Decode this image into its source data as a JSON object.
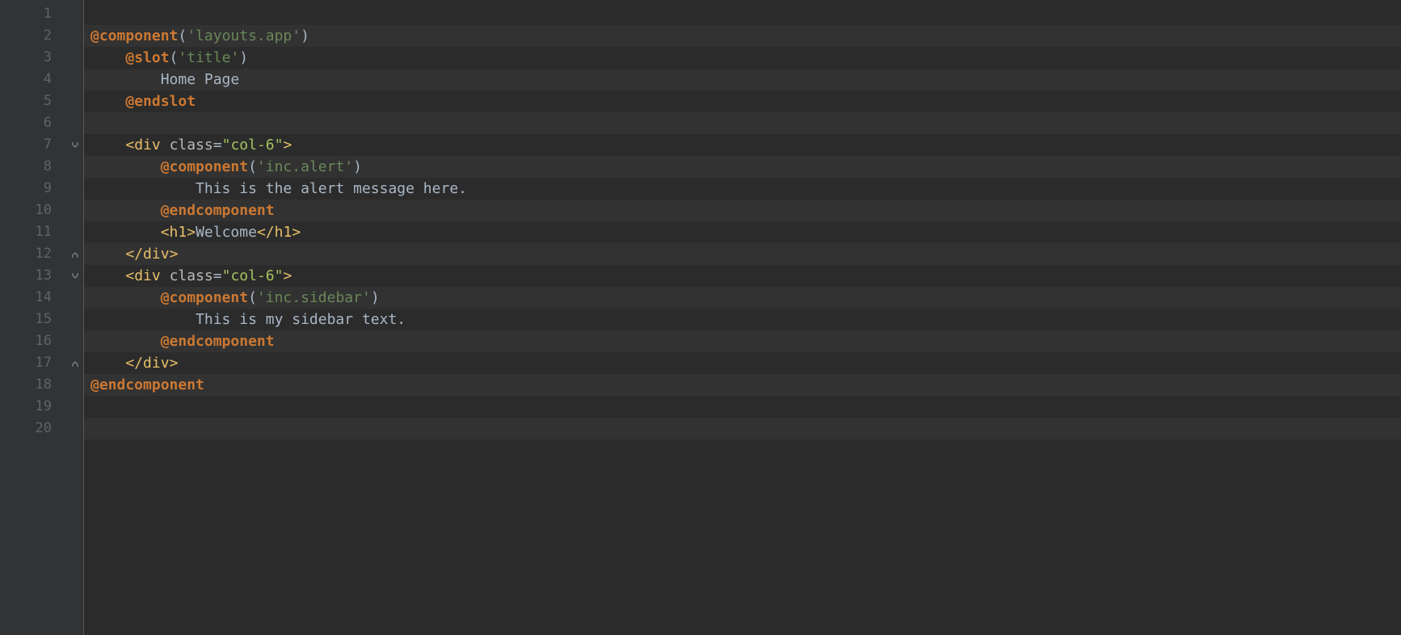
{
  "lineNumbers": [
    "1",
    "2",
    "3",
    "4",
    "5",
    "6",
    "7",
    "8",
    "9",
    "10",
    "11",
    "12",
    "13",
    "14",
    "15",
    "16",
    "17",
    "18",
    "19",
    "20"
  ],
  "foldMarkers": {
    "7": "open",
    "12": "close",
    "13": "open",
    "17": "close"
  },
  "code": {
    "lines": [
      [],
      [
        {
          "cls": "tok-directive",
          "t": "@component"
        },
        {
          "cls": "tok-paren",
          "t": "("
        },
        {
          "cls": "tok-string",
          "t": "'layouts.app'"
        },
        {
          "cls": "tok-paren",
          "t": ")"
        }
      ],
      [
        {
          "cls": "tok-text",
          "t": "    "
        },
        {
          "cls": "tok-directive",
          "t": "@slot"
        },
        {
          "cls": "tok-paren",
          "t": "("
        },
        {
          "cls": "tok-string",
          "t": "'title'"
        },
        {
          "cls": "tok-paren",
          "t": ")"
        }
      ],
      [
        {
          "cls": "tok-text",
          "t": "        Home Page"
        }
      ],
      [
        {
          "cls": "tok-text",
          "t": "    "
        },
        {
          "cls": "tok-directive",
          "t": "@endslot"
        }
      ],
      [],
      [
        {
          "cls": "tok-text",
          "t": "    "
        },
        {
          "cls": "tok-tag-bracket",
          "t": "<"
        },
        {
          "cls": "tok-tag-name",
          "t": "div "
        },
        {
          "cls": "tok-attr-name",
          "t": "class"
        },
        {
          "cls": "tok-attr-eq",
          "t": "="
        },
        {
          "cls": "tok-attr-quote",
          "t": "\""
        },
        {
          "cls": "tok-attr-value",
          "t": "col-6"
        },
        {
          "cls": "tok-attr-quote",
          "t": "\""
        },
        {
          "cls": "tok-tag-bracket",
          "t": ">"
        }
      ],
      [
        {
          "cls": "tok-text",
          "t": "        "
        },
        {
          "cls": "tok-directive",
          "t": "@component"
        },
        {
          "cls": "tok-paren",
          "t": "("
        },
        {
          "cls": "tok-string",
          "t": "'inc.alert'"
        },
        {
          "cls": "tok-paren",
          "t": ")"
        }
      ],
      [
        {
          "cls": "tok-text",
          "t": "            This is the alert message here."
        }
      ],
      [
        {
          "cls": "tok-text",
          "t": "        "
        },
        {
          "cls": "tok-directive",
          "t": "@endcomponent"
        }
      ],
      [
        {
          "cls": "tok-text",
          "t": "        "
        },
        {
          "cls": "tok-tag-bracket",
          "t": "<"
        },
        {
          "cls": "tok-tag-name",
          "t": "h1"
        },
        {
          "cls": "tok-tag-bracket",
          "t": ">"
        },
        {
          "cls": "tok-text",
          "t": "Welcome"
        },
        {
          "cls": "tok-tag-bracket",
          "t": "</"
        },
        {
          "cls": "tok-tag-name",
          "t": "h1"
        },
        {
          "cls": "tok-tag-bracket",
          "t": ">"
        }
      ],
      [
        {
          "cls": "tok-text",
          "t": "    "
        },
        {
          "cls": "tok-tag-bracket",
          "t": "</"
        },
        {
          "cls": "tok-tag-name",
          "t": "div"
        },
        {
          "cls": "tok-tag-bracket",
          "t": ">"
        }
      ],
      [
        {
          "cls": "tok-text",
          "t": "    "
        },
        {
          "cls": "tok-tag-bracket",
          "t": "<"
        },
        {
          "cls": "tok-tag-name",
          "t": "div "
        },
        {
          "cls": "tok-attr-name",
          "t": "class"
        },
        {
          "cls": "tok-attr-eq",
          "t": "="
        },
        {
          "cls": "tok-attr-quote",
          "t": "\""
        },
        {
          "cls": "tok-attr-value",
          "t": "col-6"
        },
        {
          "cls": "tok-attr-quote",
          "t": "\""
        },
        {
          "cls": "tok-tag-bracket",
          "t": ">"
        }
      ],
      [
        {
          "cls": "tok-text",
          "t": "        "
        },
        {
          "cls": "tok-directive",
          "t": "@component"
        },
        {
          "cls": "tok-paren",
          "t": "("
        },
        {
          "cls": "tok-string",
          "t": "'inc.sidebar'"
        },
        {
          "cls": "tok-paren",
          "t": ")"
        }
      ],
      [
        {
          "cls": "tok-text",
          "t": "            This is my sidebar text."
        }
      ],
      [
        {
          "cls": "tok-text",
          "t": "        "
        },
        {
          "cls": "tok-directive",
          "t": "@endcomponent"
        }
      ],
      [
        {
          "cls": "tok-text",
          "t": "    "
        },
        {
          "cls": "tok-tag-bracket",
          "t": "</"
        },
        {
          "cls": "tok-tag-name",
          "t": "div"
        },
        {
          "cls": "tok-tag-bracket",
          "t": ">"
        }
      ],
      [
        {
          "cls": "tok-directive",
          "t": "@endcomponent"
        }
      ],
      [],
      []
    ]
  }
}
